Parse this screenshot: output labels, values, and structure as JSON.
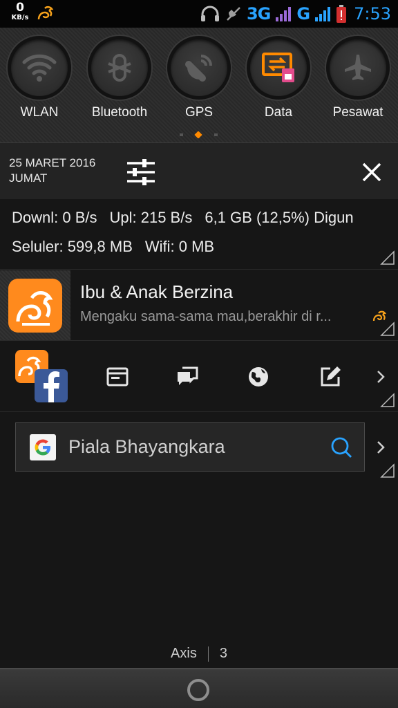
{
  "status_bar": {
    "speed_value": "0",
    "speed_unit": "KB/s",
    "network": "3G",
    "network2": "G",
    "time": "7:53"
  },
  "quick_settings": {
    "items": [
      {
        "label": "WLAN",
        "icon": "wifi-icon"
      },
      {
        "label": "Bluetooth",
        "icon": "bluetooth-icon"
      },
      {
        "label": "GPS",
        "icon": "gps-icon"
      },
      {
        "label": "Data",
        "icon": "data-icon",
        "active": true
      },
      {
        "label": "Pesawat",
        "icon": "airplane-icon"
      }
    ],
    "accent": "#ff8a00"
  },
  "date": {
    "line1": "25 MARET 2016",
    "line2": "JUMAT"
  },
  "traffic": {
    "download": "Downl: 0 B/s",
    "upload": "Upl: 215 B/s",
    "storage": "6,1 GB (12,5%) Digun",
    "cellular": "Seluler: 599,8 MB",
    "wifi": "Wifi: 0 MB"
  },
  "news": {
    "title": "Ibu & Anak Berzina",
    "subtitle": "Mengaku sama-sama mau,berakhir di r..."
  },
  "search": {
    "query": "Piala Bhayangkara"
  },
  "carrier": {
    "name": "Axis",
    "number": "3"
  }
}
